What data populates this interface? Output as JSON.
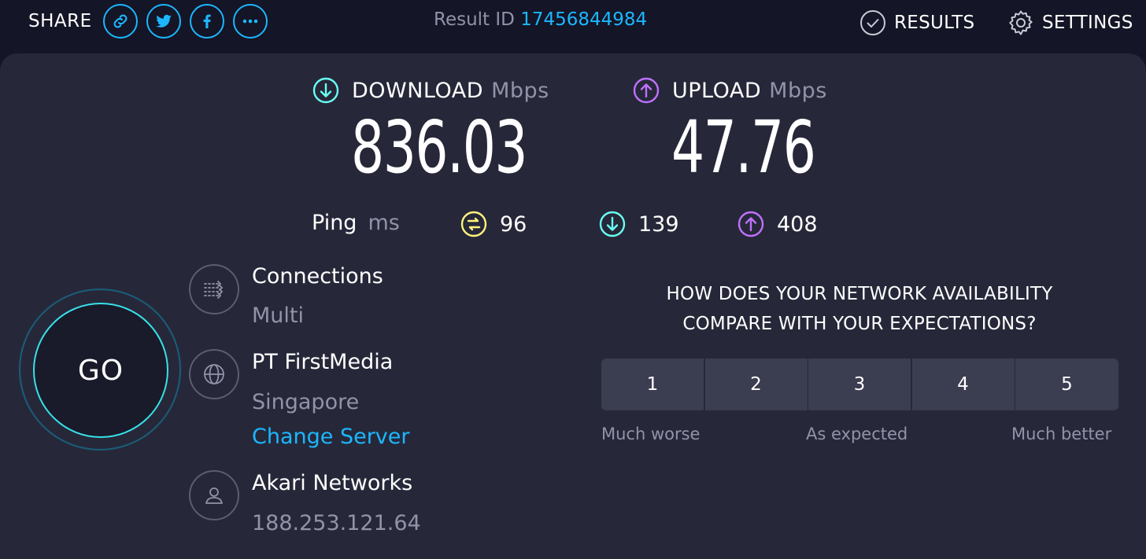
{
  "topbar": {
    "share_label": "SHARE",
    "share_icons": [
      "link-icon",
      "twitter-icon",
      "facebook-icon",
      "more-icon"
    ],
    "result_id_label": "Result ID",
    "result_id": "17456844984",
    "results_label": "RESULTS",
    "settings_label": "SETTINGS"
  },
  "download": {
    "label": "DOWNLOAD",
    "unit": "Mbps",
    "value": "836.03"
  },
  "upload": {
    "label": "UPLOAD",
    "unit": "Mbps",
    "value": "47.76"
  },
  "ping": {
    "label": "Ping",
    "unit": "ms",
    "idle": "96",
    "download": "139",
    "upload": "408"
  },
  "go_label": "GO",
  "connections": {
    "title": "Connections",
    "value": "Multi"
  },
  "server": {
    "name": "PT FirstMedia",
    "location": "Singapore",
    "change_label": "Change Server"
  },
  "provider": {
    "name": "Akari Networks",
    "ip": "188.253.121.64"
  },
  "survey": {
    "question_line1": "HOW DOES YOUR NETWORK AVAILABILITY",
    "question_line2": "COMPARE WITH YOUR EXPECTATIONS?",
    "options": [
      "1",
      "2",
      "3",
      "4",
      "5"
    ],
    "low_label": "Much worse",
    "mid_label": "As expected",
    "high_label": "Much better"
  },
  "colors": {
    "accent_blue": "#1cb7ff",
    "download_cyan": "#6afff3",
    "upload_purple": "#bf71ff",
    "ping_yellow": "#fff27c",
    "panel": "#262839",
    "background": "#141526"
  }
}
